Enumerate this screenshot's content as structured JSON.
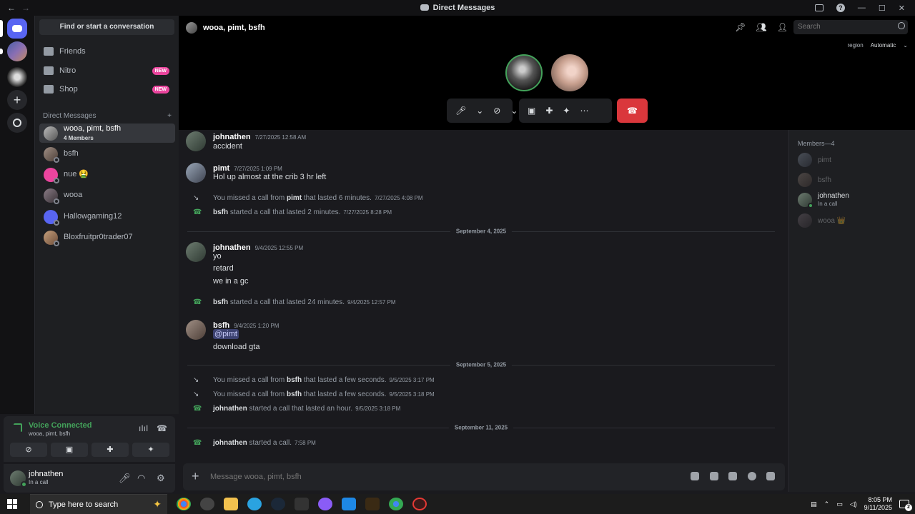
{
  "window": {
    "title": "Direct Messages"
  },
  "dm_column": {
    "find_label": "Find or start a conversation",
    "nav": [
      {
        "label": "Friends",
        "badge": ""
      },
      {
        "label": "Nitro",
        "badge": "NEW"
      },
      {
        "label": "Shop",
        "badge": "NEW"
      }
    ],
    "dm_header": "Direct Messages",
    "add_symbol": "+",
    "conversations": [
      {
        "name": "wooa, pimt, bsfh",
        "sub": "4 Members"
      },
      {
        "name": "bsfh",
        "sub": ""
      },
      {
        "name": "nue 🤮",
        "sub": ""
      },
      {
        "name": "wooa",
        "sub": ""
      },
      {
        "name": "Hallowgaming12",
        "sub": ""
      },
      {
        "name": "Bloxfruitpr0trader07",
        "sub": ""
      }
    ]
  },
  "voice": {
    "status": "Voice Connected",
    "channel": "wooa, pimt, bsfh"
  },
  "user": {
    "name": "johnathen",
    "status": "In a call"
  },
  "call": {
    "channel_title": "wooa, pimt, bsfh",
    "search_placeholder": "Search",
    "region_label": "region",
    "region_value": "Automatic"
  },
  "messages": {
    "m1": {
      "author": "johnathen",
      "time": "7/27/2025 12:58 AM",
      "lines": [
        "accident"
      ]
    },
    "m2": {
      "author": "pimt",
      "time": "7/27/2025 1:09 PM",
      "lines": [
        "Hol up almost at the crib 3 hr left"
      ]
    },
    "s1": {
      "pre": "You missed a call from ",
      "name": "pimt",
      "post": " that lasted 6 minutes.",
      "time": "7/27/2025 4:08 PM"
    },
    "s2": {
      "pre": "",
      "name": "bsfh",
      "post": " started a call that lasted 2 minutes.",
      "time": "7/27/2025 8:28 PM"
    },
    "d1": "September 4, 2025",
    "m3": {
      "author": "johnathen",
      "time": "9/4/2025 12:55 PM",
      "lines": [
        "yo",
        "retard",
        "we in a gc"
      ]
    },
    "s3": {
      "pre": "",
      "name": "bsfh",
      "post": " started a call that lasted 24 minutes.",
      "time": "9/4/2025 12:57 PM"
    },
    "m4": {
      "author": "bsfh",
      "time": "9/4/2025 1:20 PM",
      "mention": "@pimt",
      "lines": [
        "download gta"
      ]
    },
    "d2": "September 5, 2025",
    "s4": {
      "pre": "You missed a call from ",
      "name": "bsfh",
      "post": " that lasted a few seconds.",
      "time": "9/5/2025 3:17 PM"
    },
    "s5": {
      "pre": "You missed a call from ",
      "name": "bsfh",
      "post": " that lasted a few seconds.",
      "time": "9/5/2025 3:18 PM"
    },
    "s6": {
      "pre": "",
      "name": "johnathen",
      "post": " started a call that lasted an hour.",
      "time": "9/5/2025 3:18 PM"
    },
    "d3": "September 11, 2025",
    "s7": {
      "pre": "",
      "name": "johnathen",
      "post": " started a call.",
      "time": "7:58 PM"
    }
  },
  "composer": {
    "placeholder": "Message wooa, pimt, bsfh"
  },
  "members": {
    "header": "Members—4",
    "list": [
      {
        "name": "pimt",
        "sub": ""
      },
      {
        "name": "bsfh",
        "sub": ""
      },
      {
        "name": "johnathen",
        "sub": "In a call"
      },
      {
        "name": "wooa 👑",
        "sub": ""
      }
    ]
  },
  "taskbar": {
    "search_placeholder": "Type here to search",
    "time": "8:05 PM",
    "date": "9/11/2025",
    "notification_count": "2"
  },
  "colors": {
    "accent": "#5865f2",
    "online": "#43a25a",
    "hangup": "#da373c",
    "badge": "#eb459e"
  }
}
